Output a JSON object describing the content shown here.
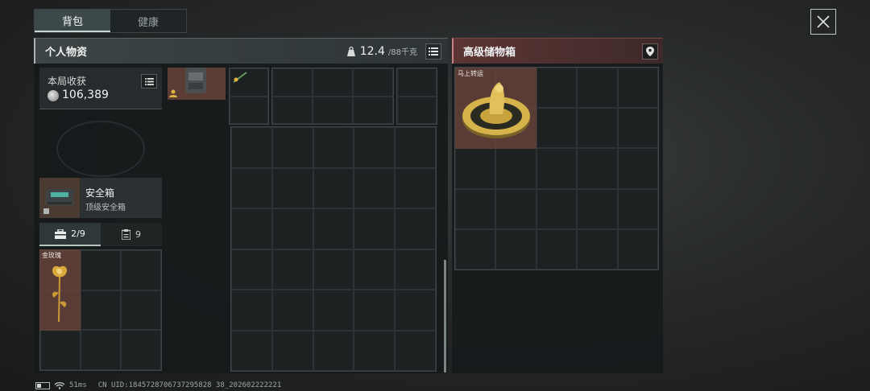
{
  "top_tabs": [
    {
      "label": "背包",
      "active": true
    },
    {
      "label": "健康",
      "active": false
    }
  ],
  "personal": {
    "title": "个人物资",
    "weight_current": "12.4",
    "weight_max": "/88千克"
  },
  "earnings": {
    "label": "本局收获",
    "value": "106,389"
  },
  "safe_box": {
    "name": "安全箱",
    "subtitle": "顶级安全箱"
  },
  "sub_tabs": [
    {
      "label": "2/9",
      "icon": "toolbox-icon",
      "active": true
    },
    {
      "label": "9",
      "icon": "clipboard-icon",
      "active": false
    }
  ],
  "items": {
    "gold_rose": "金玫瑰",
    "lucky_wheel": "马上转运"
  },
  "storage": {
    "title": "高级储物箱"
  },
  "status": {
    "ping": "51ms",
    "uid": "CN UID:1845728706737295828 38_202602222221"
  },
  "colors": {
    "accent_personal": "#aab3b1",
    "accent_storage": "#c88080",
    "item_highlight": "#6e463c"
  }
}
